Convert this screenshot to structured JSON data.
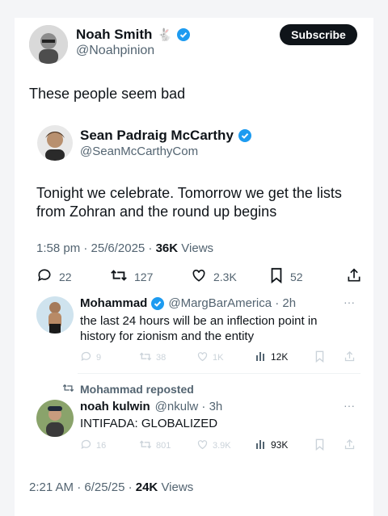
{
  "outer_tweet": {
    "author_name": "Noah Smith",
    "author_handle": "@Noahpinion",
    "subscribe_label": "Subscribe",
    "text": "These people seem bad",
    "footer_time": "2:21 AM · 6/25/25 · ",
    "footer_views": "24K",
    "footer_views_label": " Views"
  },
  "quoted_tweet": {
    "author_name": "Sean Padraig McCarthy",
    "author_handle": "@SeanMcCarthyCom",
    "text_line1": "Tonight we celebrate. Tomorrow we get the lists",
    "text_line2": "from Zohran and the round up begins",
    "meta_time": "1:58 pm · 25/6/2025 · ",
    "meta_views": "36K",
    "meta_views_label": " Views",
    "replies": "22",
    "retweets": "127",
    "likes": "2.3K",
    "bookmarks": "52"
  },
  "reply1": {
    "author_name": "Mohammad",
    "author_handle": "@MargBarAmerica · 2h",
    "text_line1": "the last 24 hours will be an inflection point in",
    "text_line2": "history for zionism and the entity",
    "replies": "9",
    "retweets": "38",
    "likes": "1K",
    "views": "12K"
  },
  "reply2": {
    "repost_label": "Mohammad reposted",
    "author_name": "noah kulwin",
    "author_handle": "@nkulw · 3h",
    "text": "INTIFADA: GLOBALIZED",
    "replies": "16",
    "retweets": "801",
    "likes": "3.9K",
    "views": "93K"
  },
  "colors": {
    "verified": "#1d9bf0",
    "text": "#0f1419",
    "secondary": "#536471"
  }
}
